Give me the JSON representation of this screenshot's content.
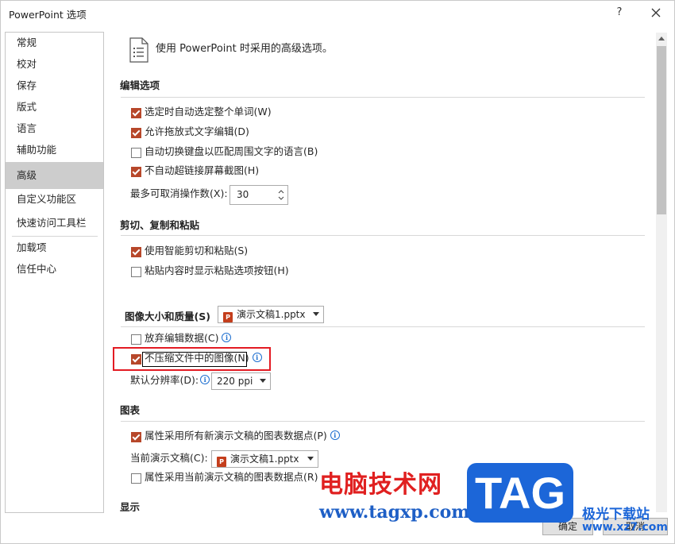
{
  "window": {
    "title": "PowerPoint 选项",
    "help": "?",
    "close": "✕"
  },
  "sidebar": {
    "items": [
      {
        "label": "常规"
      },
      {
        "label": "校对"
      },
      {
        "label": "保存"
      },
      {
        "label": "版式"
      },
      {
        "label": "语言"
      },
      {
        "label": "辅助功能"
      },
      {
        "label": "高级"
      },
      {
        "label": "自定义功能区"
      },
      {
        "label": "快速访问工具栏"
      },
      {
        "label": "加载项"
      },
      {
        "label": "信任中心"
      }
    ],
    "active": "高级"
  },
  "content": {
    "header": "使用 PowerPoint 时采用的高级选项。",
    "editing": {
      "title": "编辑选项",
      "options": [
        {
          "label": "选定时自动选定整个单词(W)",
          "checked": true
        },
        {
          "label": "允许拖放式文字编辑(D)",
          "checked": true
        },
        {
          "label": "自动切换键盘以匹配周围文字的语言(B)",
          "checked": false
        },
        {
          "label": "不自动超链接屏幕截图(H)",
          "checked": true
        }
      ],
      "undo_label": "最多可取消操作数(X):",
      "undo_value": "30"
    },
    "clipboard": {
      "title": "剪切、复制和粘贴",
      "options": [
        {
          "label": "使用智能剪切和粘贴(S)",
          "checked": true
        },
        {
          "label": "粘贴内容时显示粘贴选项按钮(H)",
          "checked": false
        }
      ]
    },
    "image": {
      "title": "图像大小和质量(S)",
      "file": "演示文稿1.pptx",
      "options": [
        {
          "label": "放弃编辑数据(C)",
          "checked": false
        },
        {
          "label": "不压缩文件中的图像(N)",
          "checked": true
        }
      ],
      "resolution_label": "默认分辨率(D):",
      "resolution_value": "220 ppi"
    },
    "chart": {
      "title": "图表",
      "options": [
        {
          "label": "属性采用所有新演示文稿的图表数据点(P)",
          "checked": true
        },
        {
          "label": "属性采用当前演示文稿的图表数据点(R)",
          "checked": false
        }
      ],
      "current_label": "当前演示文稿(C):",
      "current_file": "演示文稿1.pptx"
    },
    "display": {
      "title": "显示"
    }
  },
  "buttons": {
    "ok": "确定",
    "cancel": "取消"
  },
  "watermark": {
    "text1": "电脑技术网",
    "url1": "www.tagxp.com",
    "tag": "TAG",
    "text2": "极光下载站",
    "url2": "www.xz7.com"
  },
  "colors": {
    "accent": "#b7472a",
    "highlight": "#e31b23",
    "watermark_blue": "#1c66d8"
  }
}
